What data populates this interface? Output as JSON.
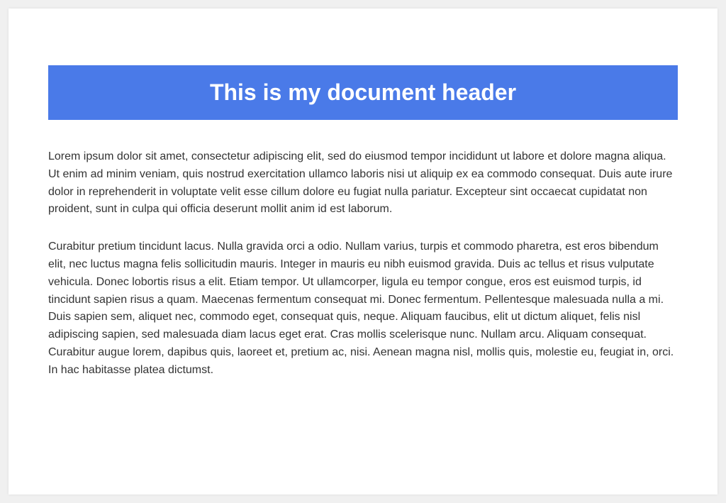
{
  "header": {
    "title": "This is my document header",
    "background_color": "#4a7ae8"
  },
  "paragraphs": [
    "Lorem ipsum dolor sit amet, consectetur adipiscing elit, sed do eiusmod tempor incididunt ut labore et dolore magna aliqua. Ut enim ad minim veniam, quis nostrud exercitation ullamco laboris nisi ut aliquip ex ea commodo consequat. Duis aute irure dolor in reprehenderit in voluptate velit esse cillum dolore eu fugiat nulla pariatur. Excepteur sint occaecat cupidatat non proident, sunt in culpa qui officia deserunt mollit anim id est laborum.",
    "Curabitur pretium tincidunt lacus. Nulla gravida orci a odio. Nullam varius, turpis et commodo pharetra, est eros bibendum elit, nec luctus magna felis sollicitudin mauris. Integer in mauris eu nibh euismod gravida. Duis ac tellus et risus vulputate vehicula. Donec lobortis risus a elit. Etiam tempor. Ut ullamcorper, ligula eu tempor congue, eros est euismod turpis, id tincidunt sapien risus a quam. Maecenas fermentum consequat mi. Donec fermentum. Pellentesque malesuada nulla a mi. Duis sapien sem, aliquet nec, commodo eget, consequat quis, neque. Aliquam faucibus, elit ut dictum aliquet, felis nisl adipiscing sapien, sed malesuada diam lacus eget erat. Cras mollis scelerisque nunc. Nullam arcu. Aliquam consequat. Curabitur augue lorem, dapibus quis, laoreet et, pretium ac, nisi. Aenean magna nisl, mollis quis, molestie eu, feugiat in, orci. In hac habitasse platea dictumst."
  ]
}
